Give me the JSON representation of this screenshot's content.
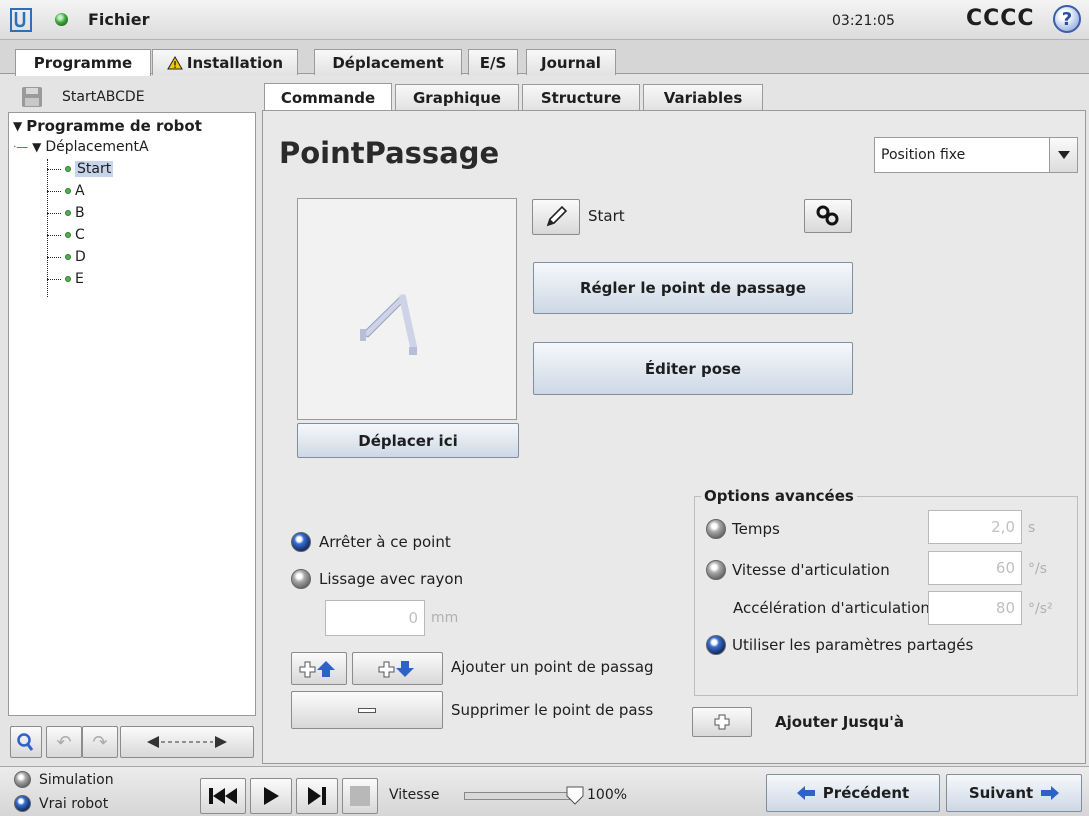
{
  "header": {
    "menu_label": "Fichier",
    "clock": "03:21:05",
    "robot_name": "CCCC",
    "help_icon": "help-icon"
  },
  "main_tabs": [
    {
      "label": "Programme"
    },
    {
      "label": "Installation",
      "warning": true
    },
    {
      "label": "Déplacement"
    },
    {
      "label": "E/S"
    },
    {
      "label": "Journal"
    }
  ],
  "program_file": "StartABCDE",
  "sub_tabs": [
    {
      "label": "Commande"
    },
    {
      "label": "Graphique"
    },
    {
      "label": "Structure"
    },
    {
      "label": "Variables"
    }
  ],
  "tree": {
    "root": "Programme de robot",
    "move": "DéplacementA",
    "items": [
      "Start",
      "A",
      "B",
      "C",
      "D",
      "E"
    ]
  },
  "waypoint": {
    "title": "PointPassage",
    "type_select": "Position fixe",
    "name": "Start",
    "set_button": "Régler le point de passage",
    "edit_button": "Éditer pose",
    "move_here_button": "Déplacer ici",
    "stop_label": "Arrêter à ce point",
    "blend_label": "Lissage avec rayon",
    "blend_value": "0",
    "blend_unit": "mm",
    "add_waypoint_label": "Ajouter un point de passag",
    "remove_waypoint_label": "Supprimer le point de pass",
    "add_until_label": "Ajouter Jusqu'à"
  },
  "advanced": {
    "legend": "Options avancées",
    "time_label": "Temps",
    "time_value": "2,0",
    "time_unit": "s",
    "speed_label": "Vitesse d'articulation",
    "speed_value": "60",
    "speed_unit": "°/s",
    "accel_label": "Accélération d'articulation",
    "accel_value": "80",
    "accel_unit": "°/s²",
    "shared_label": "Utiliser les paramètres partagés"
  },
  "footer": {
    "simulation_label": "Simulation",
    "real_robot_label": "Vrai robot",
    "speed_label": "Vitesse",
    "speed_percent": "100%",
    "speed_fraction": 1.0,
    "prev_label": "Précédent",
    "next_label": "Suivant"
  },
  "colors": {
    "accent_blue": "#2d62c8",
    "status_green": "#3aa53a",
    "warning_yellow": "#f0c800"
  }
}
